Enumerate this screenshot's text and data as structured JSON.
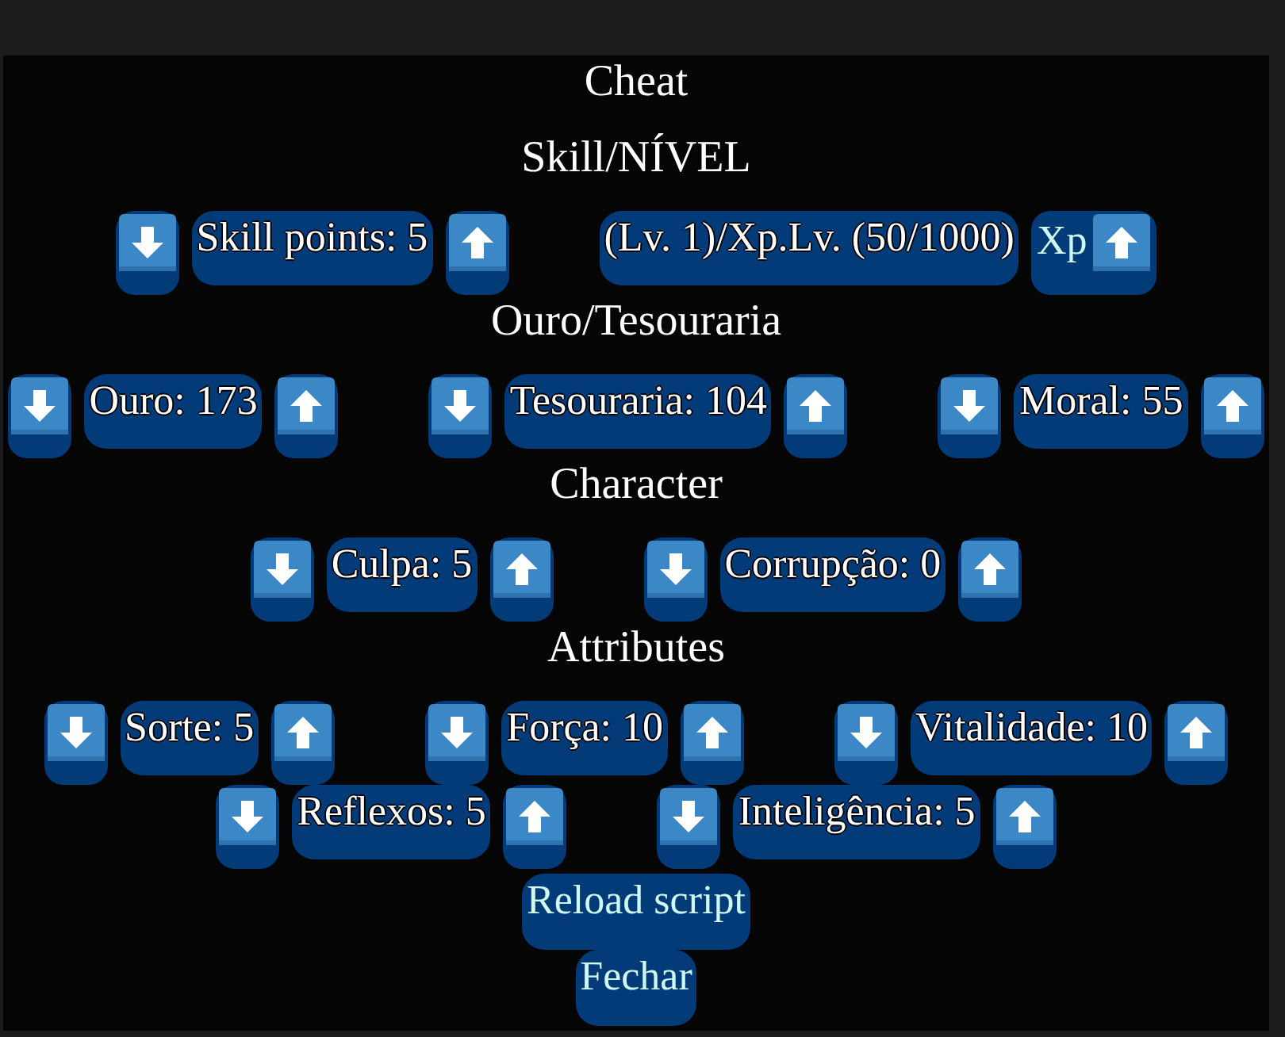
{
  "title": "Cheat",
  "sections": [
    {
      "heading": "Skill/NÍVEL",
      "rows": [
        {
          "items": [
            {
              "kind": "stepper",
              "label": "Skill points: 5"
            },
            {
              "kind": "xp",
              "label": "(Lv. 1)/Xp.Lv. (50/1000)",
              "button": "Xp"
            }
          ]
        }
      ]
    },
    {
      "heading": "Ouro/Tesouraria",
      "rows": [
        {
          "items": [
            {
              "kind": "stepper",
              "label": "Ouro: 173"
            },
            {
              "kind": "stepper",
              "label": "Tesouraria: 104"
            },
            {
              "kind": "stepper",
              "label": "Moral: 55"
            }
          ]
        }
      ]
    },
    {
      "heading": "Character",
      "rows": [
        {
          "items": [
            {
              "kind": "stepper",
              "label": "Culpa: 5"
            },
            {
              "kind": "stepper",
              "label": "Corrupção: 0"
            }
          ]
        }
      ]
    },
    {
      "heading": "Attributes",
      "rows": [
        {
          "items": [
            {
              "kind": "stepper",
              "label": "Sorte: 5"
            },
            {
              "kind": "stepper",
              "label": "Força: 10"
            },
            {
              "kind": "stepper",
              "label": "Vitalidade: 10"
            }
          ]
        },
        {
          "items": [
            {
              "kind": "stepper",
              "label": "Reflexos: 5"
            },
            {
              "kind": "stepper",
              "label": "Inteligência: 5"
            }
          ]
        }
      ]
    }
  ],
  "buttons": [
    "Reload script",
    "Fechar"
  ]
}
